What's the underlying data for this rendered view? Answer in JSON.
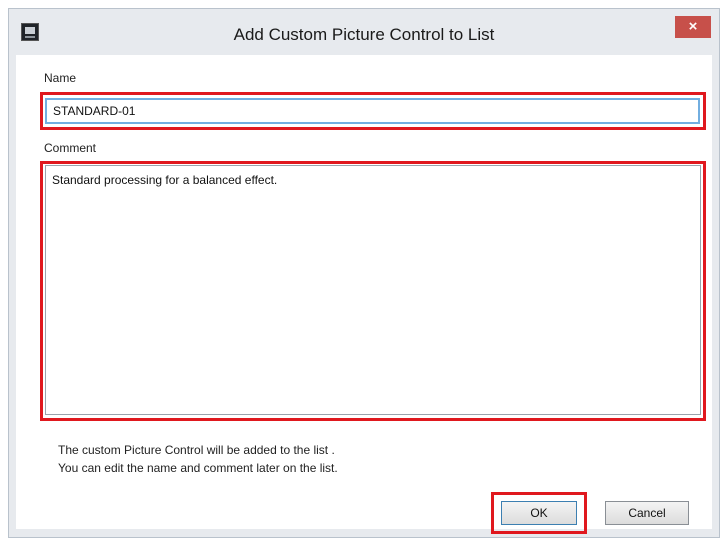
{
  "window": {
    "title": "Add Custom Picture Control to List",
    "close_glyph": "×",
    "app_icon": "picture-control-app-icon"
  },
  "name_field": {
    "label": "Name",
    "value": "STANDARD-01"
  },
  "comment_field": {
    "label": "Comment",
    "value": "Standard processing for a balanced effect."
  },
  "info": {
    "line1": "The custom Picture Control will be added to the list .",
    "line2": "You can edit the name and comment later on the list."
  },
  "buttons": {
    "ok": "OK",
    "cancel": "Cancel"
  },
  "colors": {
    "highlight": "#e0181e",
    "close_button": "#c7504a",
    "focus_border": "#72aee0"
  }
}
